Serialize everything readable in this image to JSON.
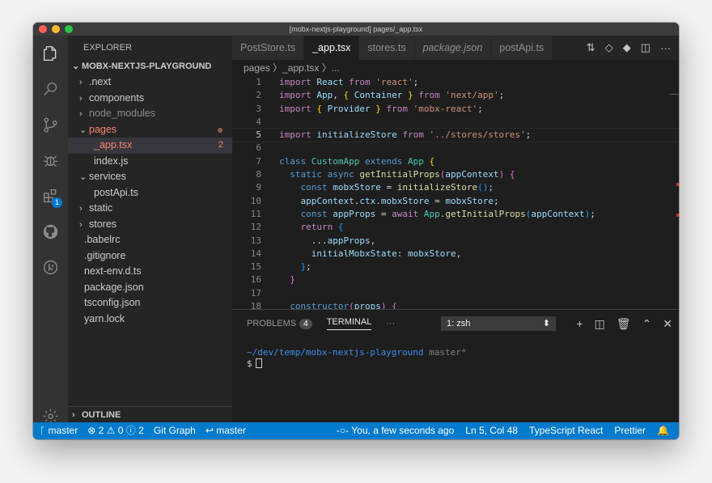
{
  "window": {
    "title": "[mobx-nextjs-playground] pages/_app.tsx"
  },
  "activity_bar": {
    "icons": [
      "files-icon",
      "search-icon",
      "source-control-icon",
      "debug-icon",
      "extensions-icon",
      "github-icon",
      "gitlens-icon",
      "settings-gear-icon"
    ],
    "extensions_badge": "1"
  },
  "sidebar": {
    "title": "EXPLORER",
    "project": "MOBX-NEXTJS-PLAYGROUND",
    "outline": "OUTLINE",
    "items": [
      {
        "label": ".next",
        "chev": "›",
        "indent": 1,
        "style": "normal"
      },
      {
        "label": "components",
        "chev": "›",
        "indent": 1,
        "style": "normal"
      },
      {
        "label": "node_modules",
        "chev": "›",
        "indent": 1,
        "style": "dim"
      },
      {
        "label": "pages",
        "chev": "⌄",
        "indent": 1,
        "style": "err"
      },
      {
        "label": "_app.tsx",
        "chev": "",
        "indent": 2,
        "style": "err-selected"
      },
      {
        "label": "index.js",
        "chev": "",
        "indent": 2,
        "style": "normal"
      },
      {
        "label": "services",
        "chev": "⌄",
        "indent": 1,
        "style": "normal"
      },
      {
        "label": "postApi.ts",
        "chev": "",
        "indent": 2,
        "style": "normal"
      },
      {
        "label": "static",
        "chev": "›",
        "indent": 1,
        "style": "normal"
      },
      {
        "label": "stores",
        "chev": "›",
        "indent": 1,
        "style": "normal"
      },
      {
        "label": ".babelrc",
        "chev": "",
        "indent": 1,
        "style": "normal"
      },
      {
        "label": ".gitignore",
        "chev": "",
        "indent": 1,
        "style": "normal"
      },
      {
        "label": "next-env.d.ts",
        "chev": "",
        "indent": 1,
        "style": "normal"
      },
      {
        "label": "package.json",
        "chev": "",
        "indent": 1,
        "style": "normal"
      },
      {
        "label": "tsconfig.json",
        "chev": "",
        "indent": 1,
        "style": "normal"
      },
      {
        "label": "yarn.lock",
        "chev": "",
        "indent": 1,
        "style": "normal"
      }
    ],
    "app_error_count": "2"
  },
  "tabs": [
    {
      "label": "PostStore.ts",
      "active": false,
      "italic": false
    },
    {
      "label": "_app.tsx",
      "active": true,
      "italic": false
    },
    {
      "label": "stores.ts",
      "active": false,
      "italic": false
    },
    {
      "label": "package.json",
      "active": false,
      "italic": true
    },
    {
      "label": "postApi.ts",
      "active": false,
      "italic": false
    }
  ],
  "tab_actions": [
    "compare-icon",
    "open-changes-icon",
    "git-commit-icon",
    "split-editor-icon",
    "more-icon"
  ],
  "breadcrumb": "pages 〉_app.tsx 〉...",
  "editor": {
    "current_line": 5,
    "lines": [
      {
        "n": "1",
        "tokens": [
          [
            "k",
            "import "
          ],
          [
            "v",
            "React "
          ],
          [
            "k",
            "from "
          ],
          [
            "s",
            "'react'"
          ],
          [
            "p",
            ";"
          ]
        ]
      },
      {
        "n": "2",
        "tokens": [
          [
            "k",
            "import "
          ],
          [
            "v",
            "App"
          ],
          [
            "p",
            ", "
          ],
          [
            "b1",
            "{ "
          ],
          [
            "v",
            "Container "
          ],
          [
            "b1",
            "} "
          ],
          [
            "k",
            "from "
          ],
          [
            "s",
            "'next/app'"
          ],
          [
            "p",
            ";"
          ]
        ]
      },
      {
        "n": "3",
        "tokens": [
          [
            "k",
            "import "
          ],
          [
            "b1",
            "{ "
          ],
          [
            "v",
            "Provider "
          ],
          [
            "b1",
            "} "
          ],
          [
            "k",
            "from "
          ],
          [
            "s",
            "'mobx-react'"
          ],
          [
            "p",
            ";"
          ]
        ]
      },
      {
        "n": "4",
        "tokens": []
      },
      {
        "n": "5",
        "tokens": [
          [
            "k",
            "import "
          ],
          [
            "v",
            "initializeStore "
          ],
          [
            "k",
            "from "
          ],
          [
            "s",
            "'../stores/stores'"
          ],
          [
            "p",
            ";"
          ]
        ]
      },
      {
        "n": "6",
        "tokens": []
      },
      {
        "n": "7",
        "tokens": [
          [
            "kw",
            "class "
          ],
          [
            "c",
            "CustomApp "
          ],
          [
            "kw",
            "extends "
          ],
          [
            "c",
            "App "
          ],
          [
            "b1",
            "{"
          ]
        ]
      },
      {
        "n": "8",
        "tokens": [
          [
            "p",
            "  "
          ],
          [
            "kw",
            "static "
          ],
          [
            "kw",
            "async "
          ],
          [
            "f",
            "getInitialProps"
          ],
          [
            "b2",
            "("
          ],
          [
            "v",
            "appContext"
          ],
          [
            "b2",
            ") "
          ],
          [
            "b2",
            "{"
          ]
        ]
      },
      {
        "n": "9",
        "tokens": [
          [
            "p",
            "    "
          ],
          [
            "kw",
            "const "
          ],
          [
            "v",
            "mobxStore "
          ],
          [
            "p",
            "= "
          ],
          [
            "f",
            "initializeStore"
          ],
          [
            "b3",
            "()"
          ],
          [
            "p",
            ";"
          ]
        ]
      },
      {
        "n": "10",
        "tokens": [
          [
            "p",
            "    "
          ],
          [
            "v",
            "appContext"
          ],
          [
            "p",
            "."
          ],
          [
            "v",
            "ctx"
          ],
          [
            "p",
            "."
          ],
          [
            "v",
            "mobxStore "
          ],
          [
            "p",
            "= "
          ],
          [
            "v",
            "mobxStore"
          ],
          [
            "p",
            ";"
          ]
        ]
      },
      {
        "n": "11",
        "tokens": [
          [
            "p",
            "    "
          ],
          [
            "kw",
            "const "
          ],
          [
            "v",
            "appProps "
          ],
          [
            "p",
            "= "
          ],
          [
            "k",
            "await "
          ],
          [
            "c",
            "App"
          ],
          [
            "p",
            "."
          ],
          [
            "f",
            "getInitialProps"
          ],
          [
            "b3",
            "("
          ],
          [
            "v",
            "appContext"
          ],
          [
            "b3",
            ")"
          ],
          [
            "p",
            ";"
          ]
        ]
      },
      {
        "n": "12",
        "tokens": [
          [
            "p",
            "    "
          ],
          [
            "k",
            "return "
          ],
          [
            "b3",
            "{"
          ]
        ]
      },
      {
        "n": "13",
        "tokens": [
          [
            "p",
            "      ..."
          ],
          [
            "v",
            "appProps"
          ],
          [
            "p",
            ","
          ]
        ]
      },
      {
        "n": "14",
        "tokens": [
          [
            "p",
            "      "
          ],
          [
            "v",
            "initialMobxState"
          ],
          [
            "p",
            ": "
          ],
          [
            "v",
            "mobxStore"
          ],
          [
            "p",
            ","
          ]
        ]
      },
      {
        "n": "15",
        "tokens": [
          [
            "p",
            "    "
          ],
          [
            "b3",
            "}"
          ],
          [
            "p",
            ";"
          ]
        ]
      },
      {
        "n": "16",
        "tokens": [
          [
            "p",
            "  "
          ],
          [
            "b2",
            "}"
          ]
        ]
      },
      {
        "n": "17",
        "tokens": []
      },
      {
        "n": "18",
        "tokens": [
          [
            "p",
            "  "
          ],
          [
            "kw",
            "constructor"
          ],
          [
            "b2",
            "("
          ],
          [
            "v",
            "props"
          ],
          [
            "b2",
            ") "
          ],
          [
            "b2",
            "{"
          ]
        ]
      }
    ]
  },
  "panel": {
    "problems_label": "PROBLEMS",
    "problems_count": "4",
    "terminal_label": "TERMINAL",
    "more": "···",
    "terminal_select": "1: zsh",
    "actions": [
      "+",
      "split-icon",
      "trash-icon",
      "chevron-up-icon",
      "close-icon"
    ],
    "term_path": "~/dev/temp/mobx-nextjs-playground",
    "term_branch": " master*",
    "term_prompt": "$"
  },
  "statusbar": {
    "branch": "master",
    "errors": "2",
    "warnings": "0",
    "infos": "2",
    "git_graph": "Git Graph",
    "sync": "master",
    "blame": "You, a few seconds ago",
    "position": "Ln 5, Col 48",
    "language": "TypeScript React",
    "formatter": "Prettier"
  }
}
